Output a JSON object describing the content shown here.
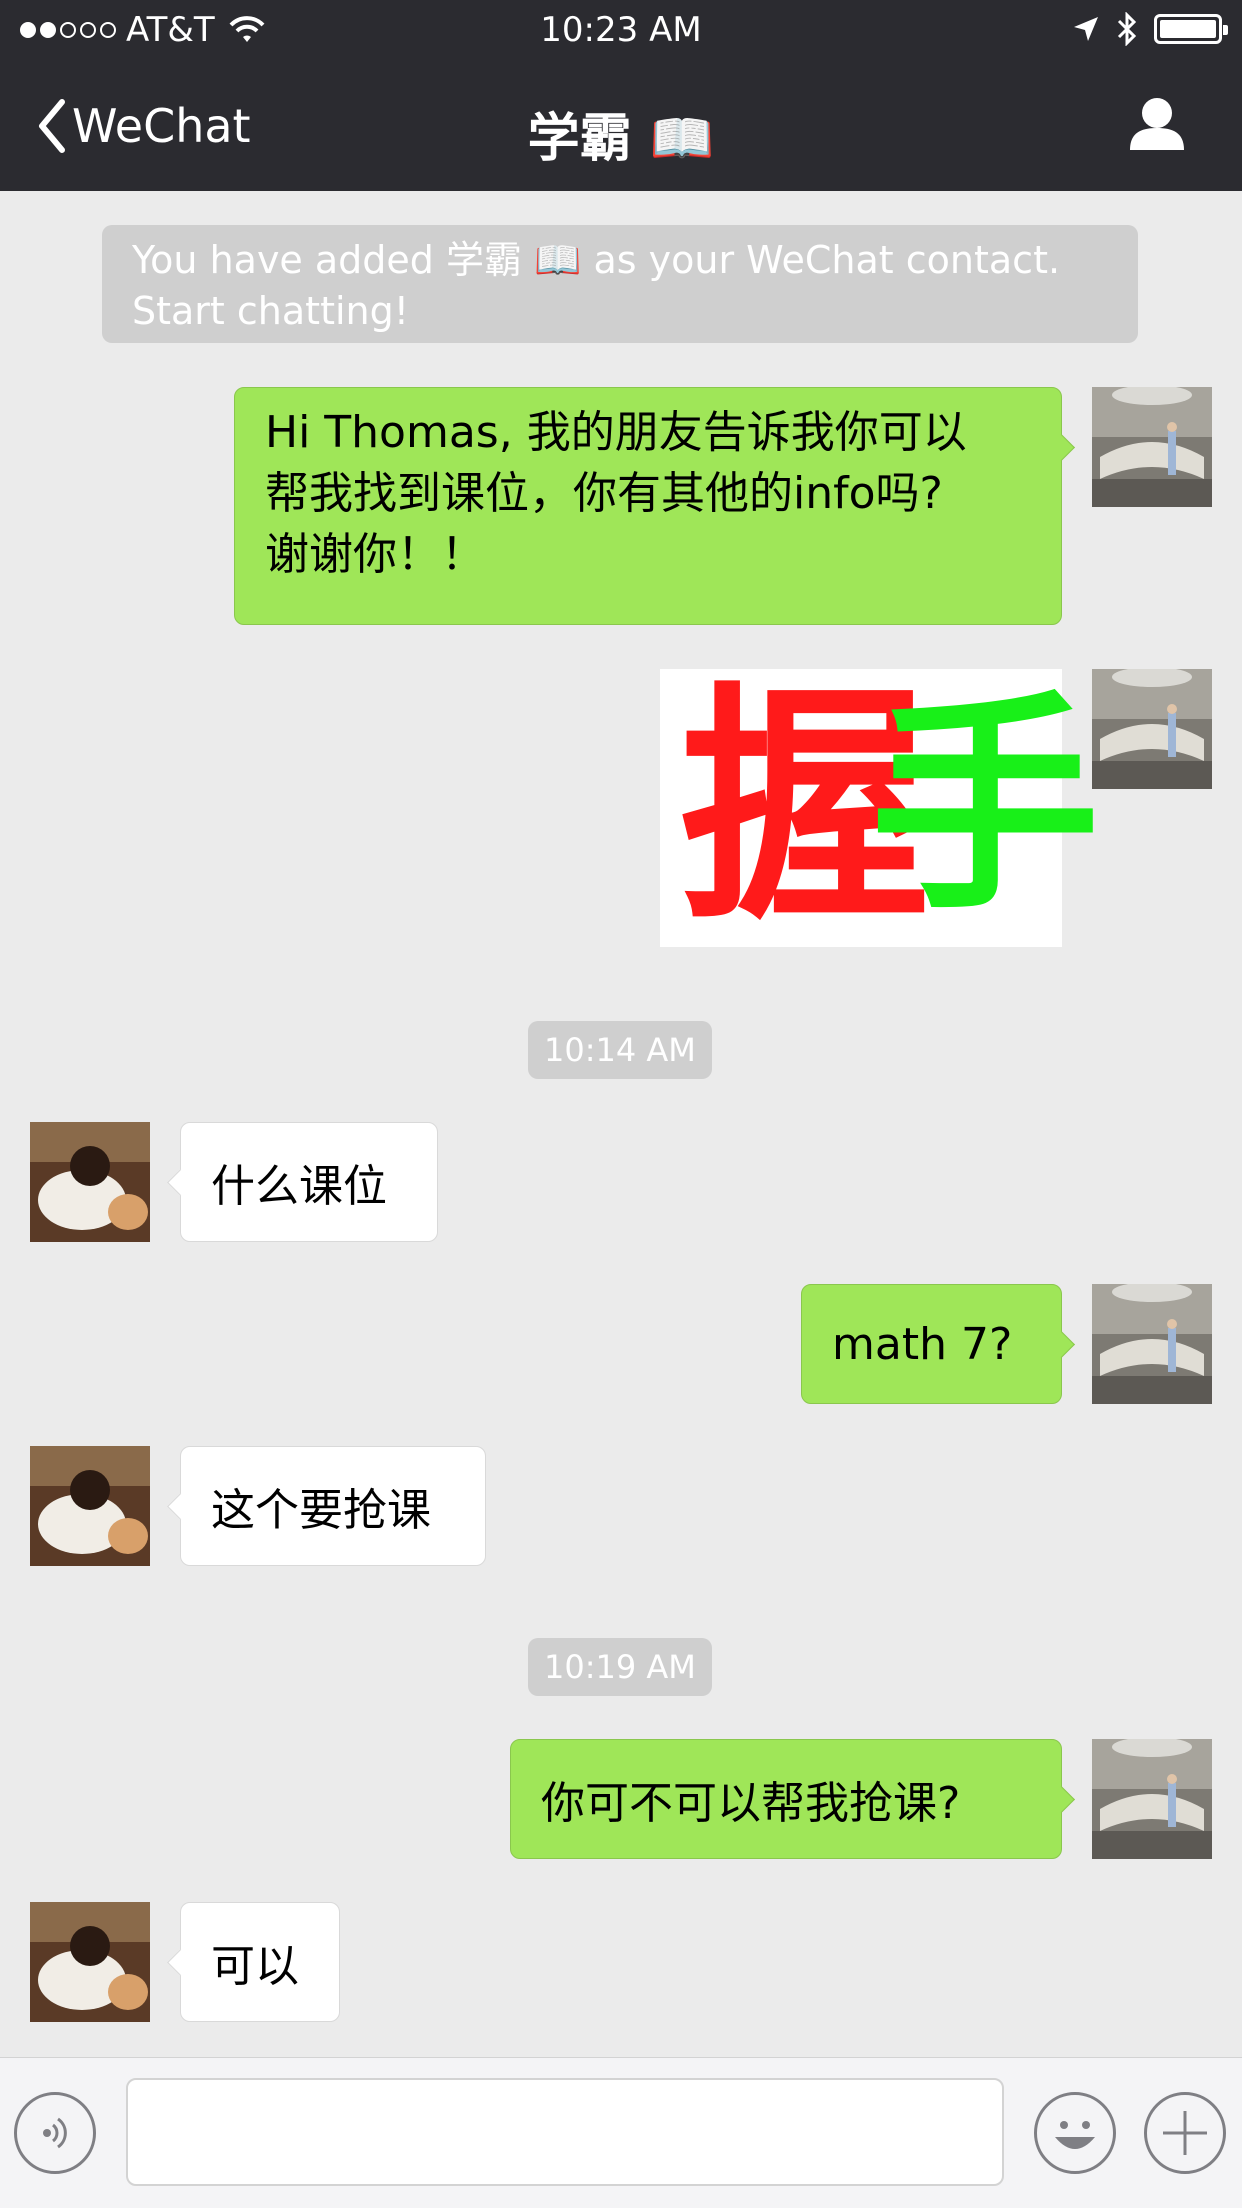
{
  "status_bar": {
    "carrier": "AT&T",
    "time": "10:23 AM",
    "signal_bars_filled": 2,
    "signal_bars_total": 5
  },
  "nav": {
    "back_label": "WeChat",
    "title": "学霸 📖"
  },
  "system_notice": {
    "line1": "You have added 学霸 📖 as your WeChat contact.",
    "line2": "Start chatting!"
  },
  "messages": [
    {
      "sender": "me",
      "lines": [
        "Hi Thomas, 我的朋友告诉我你可以",
        "帮我找到课位，你有其他的info吗?",
        "谢谢你！！"
      ]
    },
    {
      "sender": "me",
      "type": "sticker",
      "sticker_text": [
        "握",
        "手"
      ]
    },
    {
      "type": "timestamp",
      "text": "10:14 AM"
    },
    {
      "sender": "contact",
      "text": "什么课位"
    },
    {
      "sender": "me",
      "text": "math 7?"
    },
    {
      "sender": "contact",
      "text": "这个要抢课"
    },
    {
      "type": "timestamp",
      "text": "10:19 AM"
    },
    {
      "sender": "me",
      "text": "你可不可以帮我抢课?"
    },
    {
      "sender": "contact",
      "text": "可以"
    }
  ],
  "input": {
    "value": "",
    "placeholder": ""
  },
  "icons": {
    "back": "chevron-left-icon",
    "profile": "person-icon",
    "voice": "voice-icon",
    "emoji": "emoji-icon",
    "more": "plus-icon",
    "location": "location-arrow-icon",
    "bluetooth": "bluetooth-icon",
    "wifi": "wifi-icon",
    "battery": "battery-icon"
  },
  "colors": {
    "bar_bg": "#2b2b30",
    "chat_bg": "#ebebeb",
    "outgoing_bubble": "#9fe658",
    "incoming_bubble": "#ffffff",
    "notice_bg": "#cfcfcf"
  }
}
